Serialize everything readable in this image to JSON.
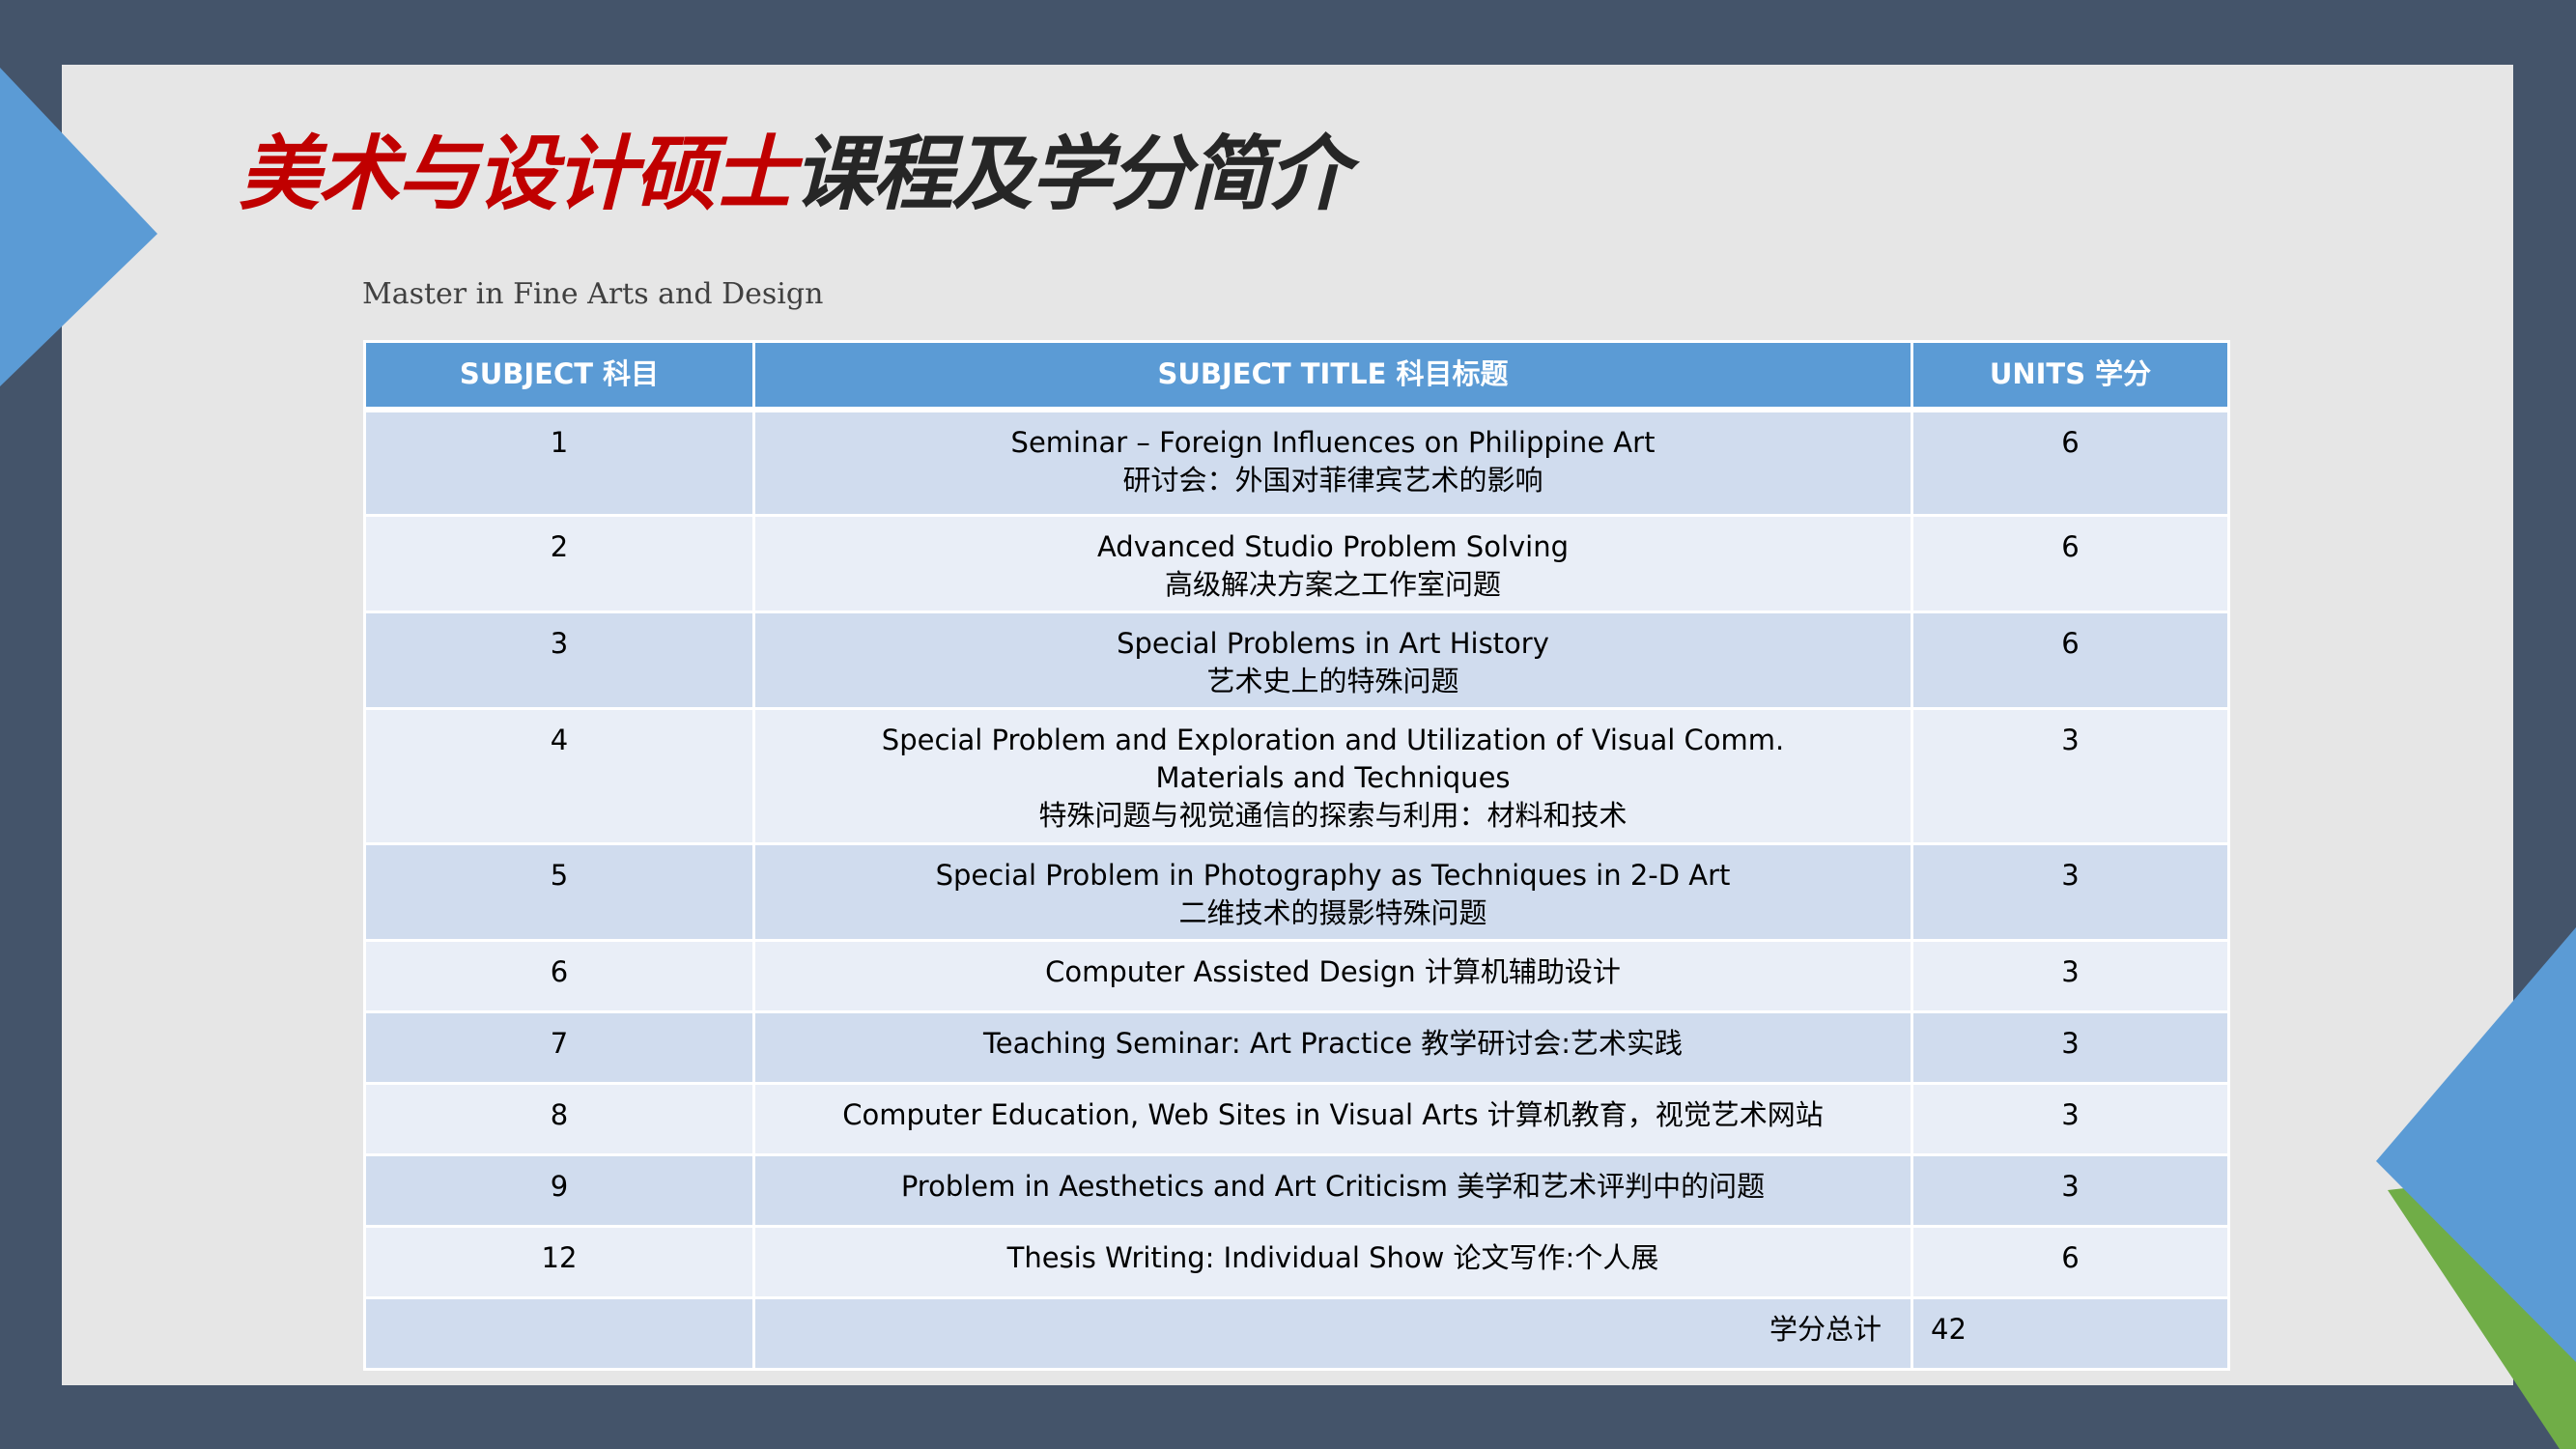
{
  "colors": {
    "frame": "#44546a",
    "slide_bg": "#e6e6e6",
    "accent_blue": "#5b9bd5",
    "accent_green": "#70ad47",
    "title_red": "#c00000",
    "title_dark": "#262626",
    "row_odd": "#d0dcee",
    "row_even": "#e9eef7"
  },
  "title": {
    "part_red": "美术与设计硕士",
    "part_dark": "课程及学分简介"
  },
  "subtitle": "Master in Fine Arts and Design",
  "table": {
    "headers": [
      "SUBJECT 科目",
      "SUBJECT TITLE 科目标题",
      "UNITS 学分"
    ],
    "rows": [
      {
        "subject": "1",
        "title_lines": [
          "Seminar – Foreign Influences on Philippine Art",
          "研讨会：外国对菲律宾艺术的影响"
        ],
        "units": "6"
      },
      {
        "subject": "2",
        "title_lines": [
          "Advanced Studio Problem Solving",
          "高级解决方案之工作室问题"
        ],
        "units": "6"
      },
      {
        "subject": "3",
        "title_lines": [
          "Special Problems in Art History",
          "艺术史上的特殊问题"
        ],
        "units": "6"
      },
      {
        "subject": "4",
        "title_lines": [
          "Special Problem and Exploration and Utilization of Visual Comm.",
          "Materials and Techniques",
          "特殊问题与视觉通信的探索与利用：材料和技术"
        ],
        "units": "3"
      },
      {
        "subject": "5",
        "title_lines": [
          "Special Problem in Photography as Techniques in 2-D Art",
          "二维技术的摄影特殊问题"
        ],
        "units": "3"
      },
      {
        "subject": "6",
        "title_lines": [
          "Computer Assisted Design 计算机辅助设计"
        ],
        "units": "3"
      },
      {
        "subject": "7",
        "title_lines": [
          "Teaching Seminar: Art Practice  教学研讨会:艺术实践"
        ],
        "units": "3"
      },
      {
        "subject": "8",
        "title_lines": [
          "Computer Education, Web Sites in Visual Arts 计算机教育，视觉艺术网站"
        ],
        "units": "3"
      },
      {
        "subject": "9",
        "title_lines": [
          "Problem in Aesthetics and Art Criticism 美学和艺术评判中的问题"
        ],
        "units": "3"
      },
      {
        "subject": "12",
        "title_lines": [
          "Thesis Writing: Individual Show 论文写作:个人展"
        ],
        "units": "6"
      }
    ],
    "total_label": "学分总计",
    "total_value": "42"
  }
}
